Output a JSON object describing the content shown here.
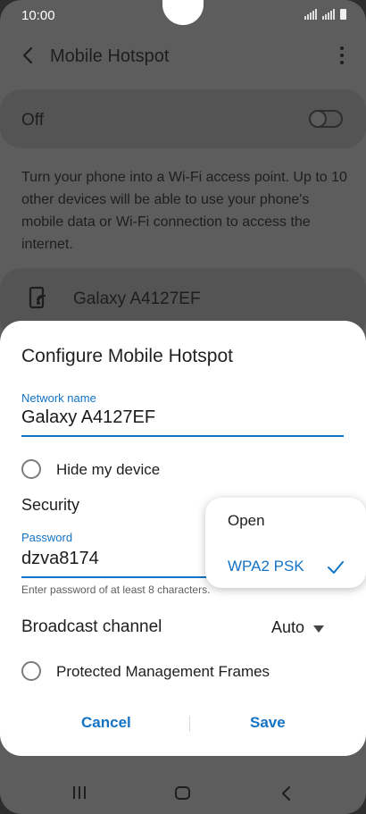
{
  "status_bar": {
    "time": "10:00"
  },
  "app_bar": {
    "title": "Mobile Hotspot"
  },
  "main": {
    "switch_label": "Off",
    "description": "Turn your phone into a Wi-Fi access point. Up to 10 other devices will be able to use your phone's mobile data or Wi-Fi connection to access the internet.",
    "network_card_name": "Galaxy A4127EF"
  },
  "dialog": {
    "title": "Configure Mobile Hotspot",
    "network_name_label": "Network name",
    "network_name_value": "Galaxy A4127EF",
    "hide_device_label": "Hide my device",
    "security_label": "Security",
    "password_label": "Password",
    "password_value": "dzva8174",
    "password_helper": "Enter password of at least 8 characters.",
    "broadcast_label": "Broadcast channel",
    "broadcast_value": "Auto",
    "pmf_label": "Protected Management Frames",
    "cancel_label": "Cancel",
    "save_label": "Save"
  },
  "security_dropdown": {
    "options": [
      "Open",
      "WPA2 PSK"
    ],
    "selected": "WPA2 PSK"
  },
  "colors": {
    "accent": "#1373c4",
    "scrim_bg": "#5d5d5d",
    "dialog_bg": "#ffffff"
  },
  "icons": [
    "back-icon",
    "more-options-icon",
    "hotspot-icon",
    "check-icon",
    "nav-recents-icon",
    "nav-home-icon",
    "nav-back-icon",
    "signal-icon",
    "battery-icon"
  ]
}
